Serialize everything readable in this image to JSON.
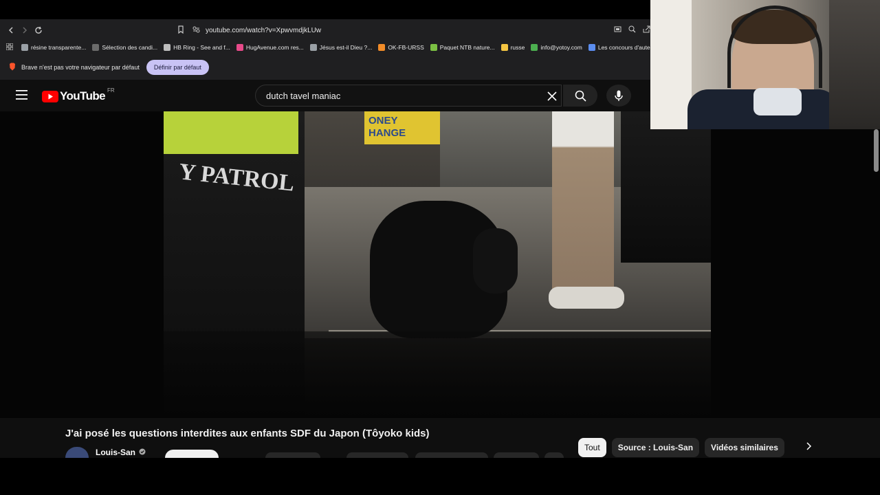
{
  "browser": {
    "url": "youtube.com/watch?v=XpwvmdjkLUw",
    "bookmarks": [
      {
        "label": "résine transparente...",
        "color": "#9aa0a6"
      },
      {
        "label": "Sélection des candi...",
        "color": "#6b6b6b"
      },
      {
        "label": "HB Ring - See and f...",
        "color": "#bdbdbd"
      },
      {
        "label": "HugAvenue.com res...",
        "color": "#e84a8a"
      },
      {
        "label": "Jésus est-il Dieu ?...",
        "color": "#9aa0a6"
      },
      {
        "label": "OK-FB-URSS",
        "color": "#f28c28"
      },
      {
        "label": "Paquet NTB nature...",
        "color": "#7bc043"
      },
      {
        "label": "russe",
        "color": "#f4c542"
      },
      {
        "label": "info@yotoy.com",
        "color": "#4caf50"
      },
      {
        "label": "Les concours d'aute...",
        "color": "#5b8def"
      }
    ],
    "notice_text": "Brave n'est pas votre navigateur par défaut",
    "notice_button": "Définir par défaut"
  },
  "youtube": {
    "logo_text": "YouTube",
    "region": "FR",
    "search_value": "dutch tavel maniac"
  },
  "video": {
    "title": "J'ai posé les questions interdites aux enfants SDF du Japon (Tôyoko kids)",
    "channel": "Louis-San",
    "scene_sign_text": "ONEY\nHANGE",
    "scene_vest_text": "Y PATROL"
  },
  "chips": [
    "Tout",
    "Source : Louis-San",
    "Vidéos similaires"
  ],
  "colors": {
    "youtube_red": "#ff0000",
    "notice_button_bg": "#c9c3f5",
    "page_bg": "#0f0f0f"
  }
}
